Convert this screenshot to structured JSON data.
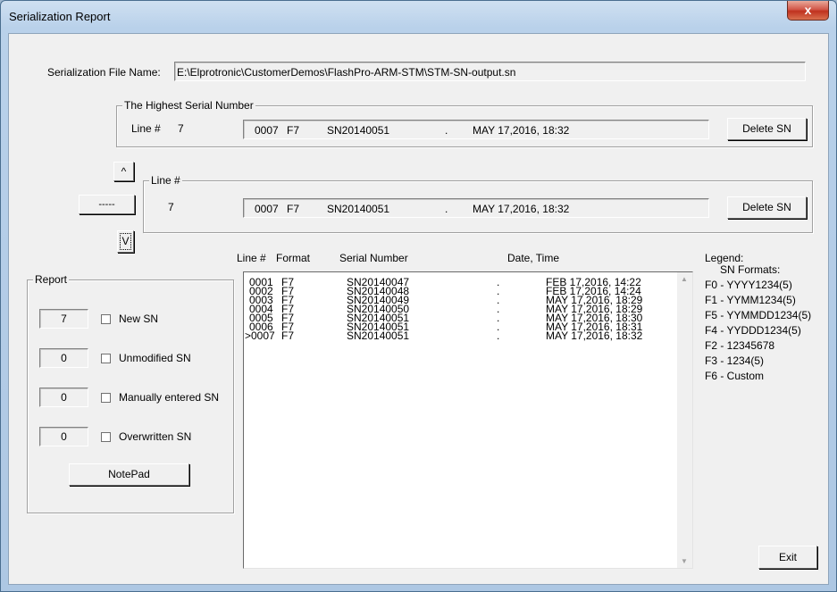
{
  "window": {
    "title": "Serialization Report",
    "close_glyph": "x"
  },
  "file": {
    "label": "Serialization File Name:",
    "value": "E:\\Elprotronic\\CustomerDemos\\FlashPro-ARM-STM\\STM-SN-output.sn"
  },
  "highest": {
    "group_title": "The Highest Serial Number",
    "line_label": "Line #",
    "line_value": "7",
    "record": {
      "line": "0007",
      "format": "F7",
      "serial": "SN20140051",
      "sep": ".",
      "date": "MAY 17,2016, 18:32"
    },
    "delete_label": "Delete SN"
  },
  "current": {
    "up_glyph": "^",
    "down_glyph": "V",
    "dash_label": "-----",
    "group_title": "Line #",
    "line_value": "7",
    "record": {
      "line": "0007",
      "format": "F7",
      "serial": "SN20140051",
      "sep": ".",
      "date": "MAY 17,2016, 18:32"
    },
    "delete_label": "Delete SN"
  },
  "report": {
    "group_title": "Report",
    "items": [
      {
        "count": "7",
        "label": "New SN"
      },
      {
        "count": "0",
        "label": "Unmodified SN"
      },
      {
        "count": "0",
        "label": "Manually entered SN"
      },
      {
        "count": "0",
        "label": "Overwritten SN"
      }
    ],
    "notepad_label": "NotePad"
  },
  "table": {
    "headers": {
      "line": "Line #",
      "format": "Format",
      "serial": "Serial Number",
      "date": "Date, Time"
    },
    "rows": [
      {
        "line": "0001",
        "format": "F7",
        "serial": "SN20140047",
        "sep": ".",
        "date": "FEB 17,2016, 14:22"
      },
      {
        "line": "0002",
        "format": "F7",
        "serial": "SN20140048",
        "sep": ".",
        "date": "FEB 17,2016, 14:24"
      },
      {
        "line": "0003",
        "format": "F7",
        "serial": "SN20140049",
        "sep": ".",
        "date": "MAY 17,2016, 18:29"
      },
      {
        "line": "0004",
        "format": "F7",
        "serial": "SN20140050",
        "sep": ".",
        "date": "MAY 17,2016, 18:29"
      },
      {
        "line": "0005",
        "format": "F7",
        "serial": "SN20140051",
        "sep": ".",
        "date": "MAY 17,2016, 18:30"
      },
      {
        "line": "0006",
        "format": "F7",
        "serial": "SN20140051",
        "sep": ".",
        "date": "MAY 17,2016, 18:31"
      },
      {
        "line": ">0007",
        "format": "F7",
        "serial": "SN20140051",
        "sep": ".",
        "date": "MAY 17,2016, 18:32"
      }
    ],
    "scroll_up_glyph": "▲",
    "scroll_down_glyph": "▼"
  },
  "legend": {
    "title": "Legend:",
    "subtitle": "SN Formats:",
    "items": [
      "F0 - YYYY1234(5)",
      "F1 - YYMM1234(5)",
      "F5 - YYMMDD1234(5)",
      "F4 - YYDDD1234(5)",
      "F2 - 12345678",
      "F3 - 1234(5)",
      "F6 - Custom"
    ]
  },
  "exit_label": "Exit"
}
